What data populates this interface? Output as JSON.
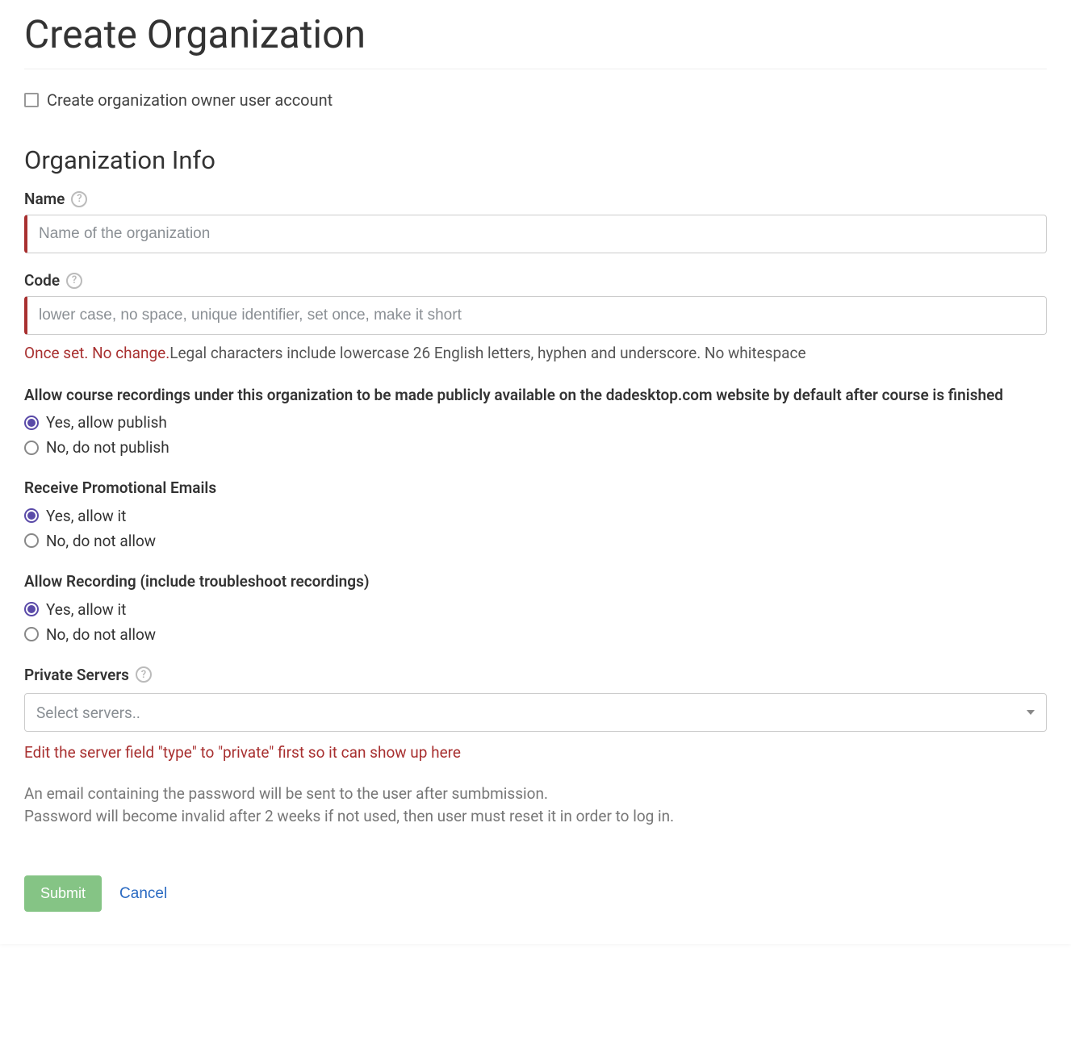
{
  "page": {
    "title": "Create Organization"
  },
  "owner": {
    "checkbox_label": "Create organization owner user account",
    "checked": false
  },
  "section": {
    "title": "Organization Info"
  },
  "name_field": {
    "label": "Name",
    "placeholder": "Name of the organization",
    "value": ""
  },
  "code_field": {
    "label": "Code",
    "placeholder": "lower case, no space, unique identifier, set once, make it short",
    "value": "",
    "hint_danger": "Once set. No change.",
    "hint_rest": "Legal characters include lowercase 26 English letters, hyphen and underscore. No whitespace"
  },
  "publish": {
    "question": "Allow course recordings under this organization to be made publicly available on the dadesktop.com website by default after course is finished",
    "yes": "Yes, allow publish",
    "no": "No, do not publish",
    "selected": "yes"
  },
  "promo": {
    "question": "Receive Promotional Emails",
    "yes": "Yes, allow it",
    "no": "No, do not allow",
    "selected": "yes"
  },
  "recording": {
    "question": "Allow Recording (include troubleshoot recordings)",
    "yes": "Yes, allow it",
    "no": "No, do not allow",
    "selected": "yes"
  },
  "private_servers": {
    "label": "Private Servers",
    "placeholder": "Select servers..",
    "hint": "Edit the server field \"type\" to \"private\" first so it can show up here"
  },
  "note": {
    "line1": "An email containing the password will be sent to the user after sumbmission.",
    "line2": "Password will become invalid after 2 weeks if not used, then user must reset it in order to log in."
  },
  "actions": {
    "submit": "Submit",
    "cancel": "Cancel"
  }
}
